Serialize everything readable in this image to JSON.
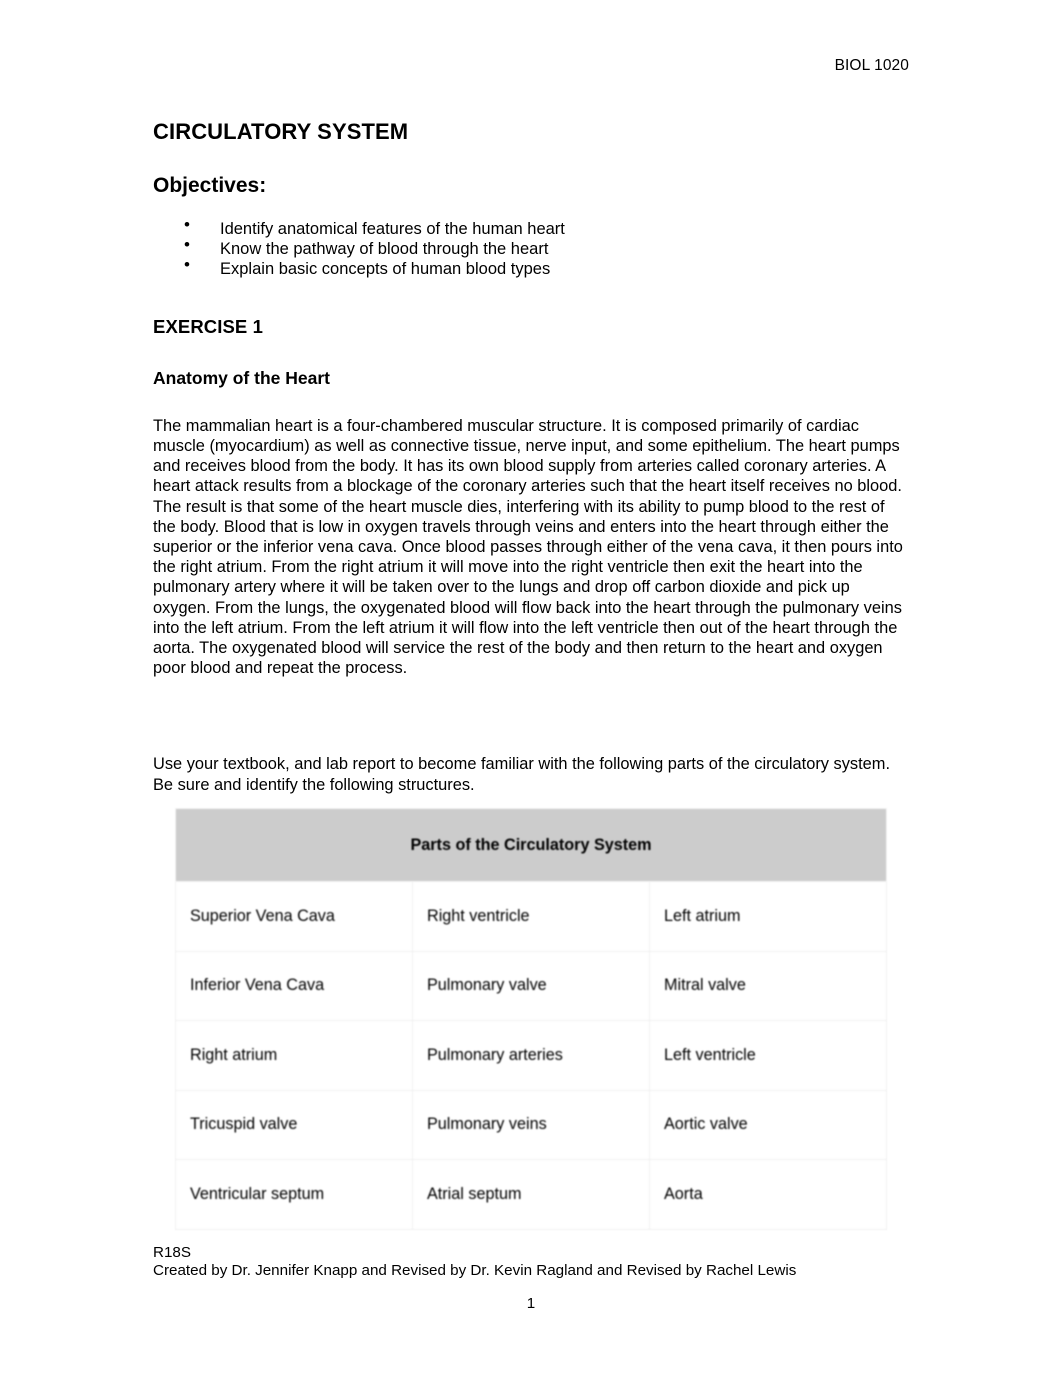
{
  "header": {
    "course_code": "BIOL 1020"
  },
  "title": "CIRCULATORY SYSTEM",
  "objectives": {
    "heading": "Objectives:",
    "bullet_glyph": "•",
    "items": [
      "Identify anatomical features of the human heart",
      "Know the pathway of blood through the heart",
      "Explain basic concepts of human blood types"
    ]
  },
  "exercise": {
    "label": "EXERCISE 1",
    "section_heading": "Anatomy of the Heart",
    "body": "The mammalian heart is a four-chambered muscular structure. It is composed primarily of cardiac muscle (myocardium) as well as connective tissue, nerve input, and some epithelium. The heart pumps and receives blood from the body. It has its own blood supply from arteries called coronary arteries. A heart attack results from a blockage of the coronary arteries such that the heart itself receives no blood. The result is that some of the heart muscle dies, interfering with its ability to pump blood to the rest of the body. Blood that is low in oxygen travels through veins and enters into the heart through either the superior or the inferior vena cava. Once blood passes through either of the vena cava, it then pours into the right atrium. From the right atrium it will move into the right ventricle then exit the heart into the pulmonary artery where it will be taken over to the lungs and drop off carbon dioxide and pick up oxygen. From the lungs, the oxygenated blood will flow back into the heart through the pulmonary veins into the left atrium. From the left atrium it will flow into the left ventricle then out of the heart through the aorta. The oxygenated blood will service the rest of the body and then return to the heart and oxygen poor blood and repeat the process.",
    "instruction": "Use your textbook, and lab report to become familiar with the following parts of the circulatory system. Be sure and identify the following structures."
  },
  "parts_table": {
    "header": "Parts of the Circulatory System",
    "header_background": "#cccccc",
    "rows": [
      [
        "Superior Vena Cava",
        "Right ventricle",
        "Left atrium"
      ],
      [
        "Inferior Vena Cava",
        "Pulmonary valve",
        "Mitral valve"
      ],
      [
        "Right atrium",
        "Pulmonary arteries",
        "Left ventricle"
      ],
      [
        "Tricuspid valve",
        "Pulmonary veins",
        "Aortic valve"
      ],
      [
        "Ventricular septum",
        "Atrial septum",
        "Aorta"
      ]
    ]
  },
  "footer": {
    "revision_code": "R18S",
    "credits": "Created by Dr. Jennifer Knapp and Revised by Dr. Kevin Ragland and Revised by Rachel Lewis",
    "page_number": "1"
  }
}
